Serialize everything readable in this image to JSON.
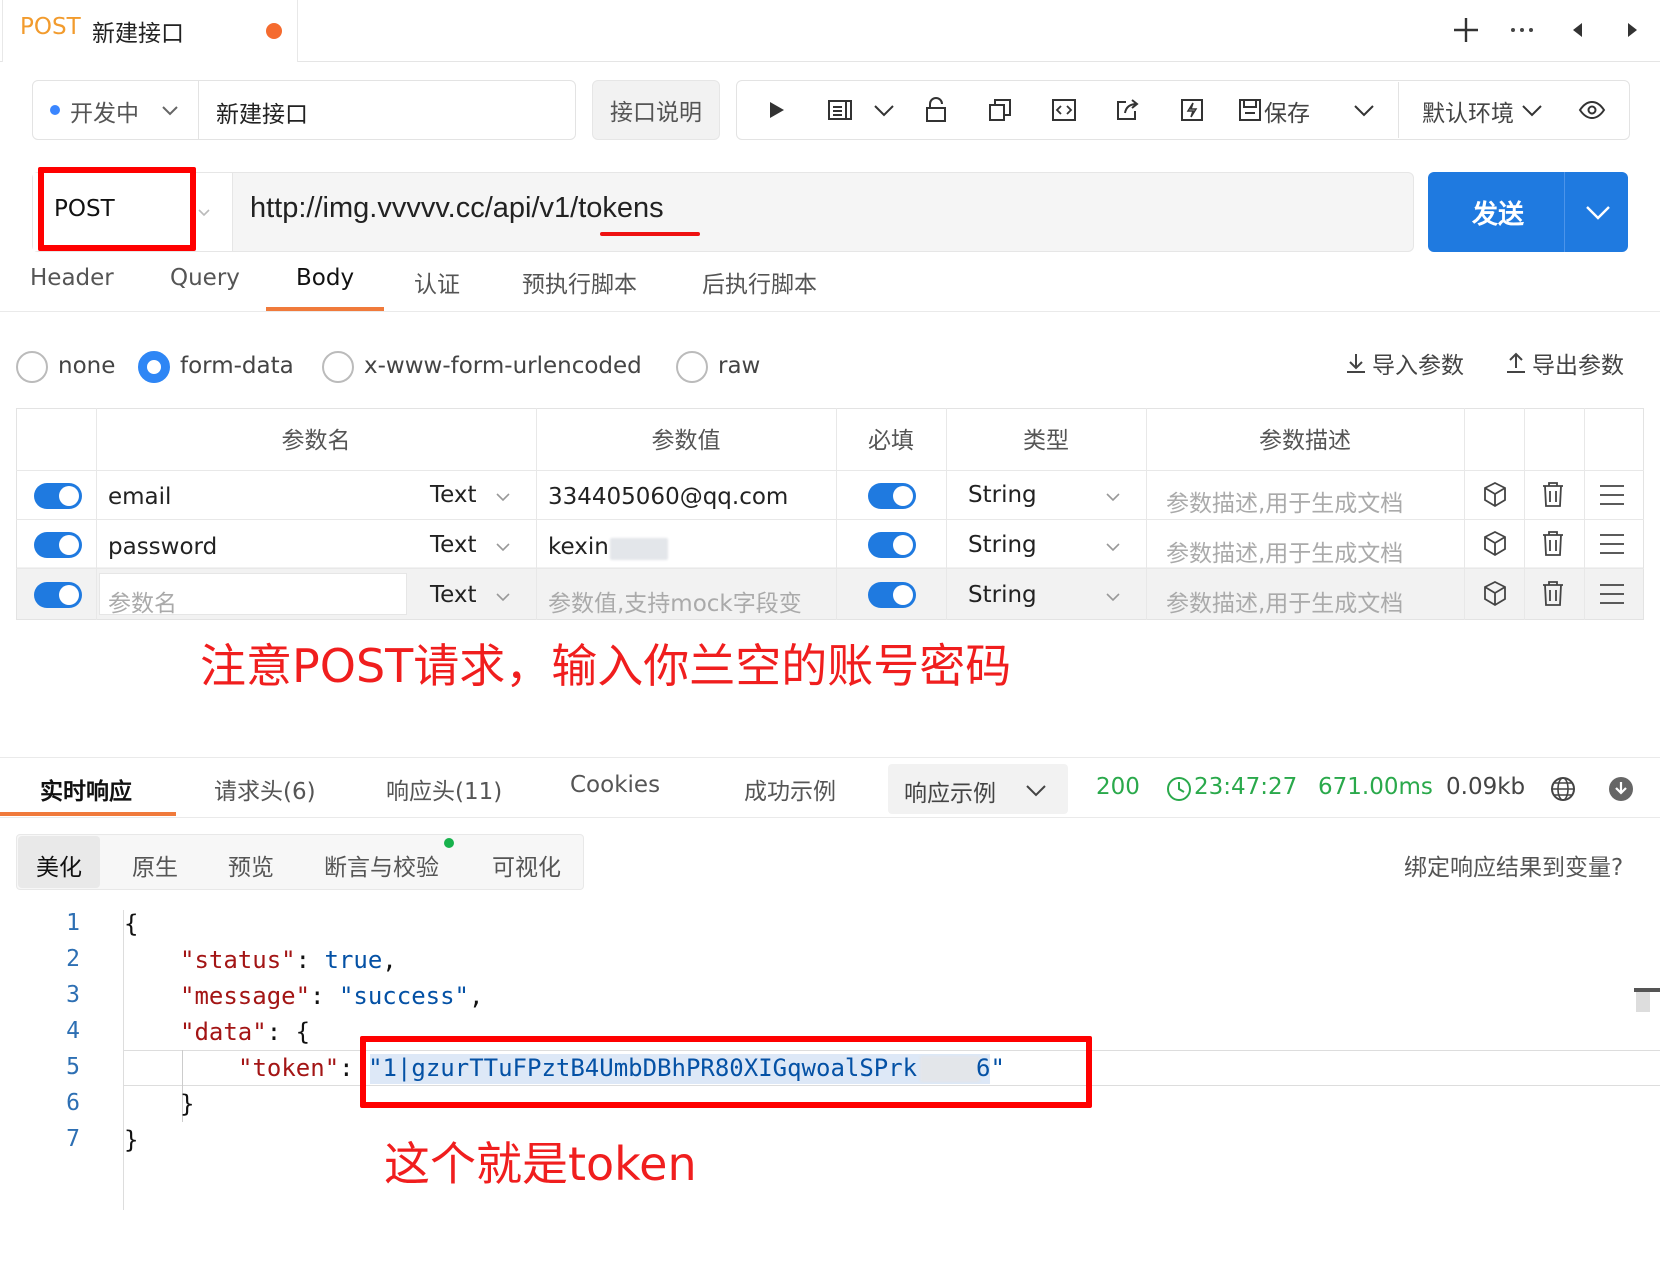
{
  "tab": {
    "method": "POST",
    "name": "新建接口"
  },
  "toolbar": {
    "status": "开发中",
    "api_name": "新建接口",
    "doc_button": "接口说明",
    "save_label": "保存",
    "environment": "默认环境"
  },
  "url_bar": {
    "method": "POST",
    "url": "http://img.vvvvv.cc/api/v1/tokens",
    "send_label": "发送"
  },
  "request_tabs": [
    "Header",
    "Query",
    "Body",
    "认证",
    "预执行脚本",
    "后执行脚本"
  ],
  "request_tab_active": "Body",
  "body_types": [
    "none",
    "form-data",
    "x-www-form-urlencoded",
    "raw"
  ],
  "body_type_selected": "form-data",
  "import_label": "导入参数",
  "export_label": "导出参数",
  "params_table": {
    "headers": [
      "参数名",
      "参数值",
      "必填",
      "类型",
      "参数描述"
    ],
    "rows": [
      {
        "enabled": true,
        "name": "email",
        "format": "Text",
        "value": "334405060@qq.com",
        "required": true,
        "type": "String",
        "description_placeholder": "参数描述,用于生成文档"
      },
      {
        "enabled": true,
        "name": "password",
        "format": "Text",
        "value": "kexin",
        "required": true,
        "type": "String",
        "description_placeholder": "参数描述,用于生成文档"
      },
      {
        "enabled": true,
        "name_placeholder": "参数名",
        "format": "Text",
        "value_placeholder": "参数值,支持mock字段变",
        "required": true,
        "type": "String",
        "description_placeholder": "参数描述,用于生成文档"
      }
    ]
  },
  "annotations": {
    "note_request": "注意POST请求，输入你兰空的账号密码",
    "note_token": "这个就是token"
  },
  "response_tabs": [
    "实时响应",
    "请求头(6)",
    "响应头(11)",
    "Cookies",
    "成功示例"
  ],
  "response_tab_active": "实时响应",
  "response_example_select": "响应示例",
  "response_stats": {
    "status": "200",
    "time": "23:47:27",
    "duration": "671.00ms",
    "size": "0.09kb"
  },
  "view_tabs": [
    "美化",
    "原生",
    "预览",
    "断言与校验",
    "可视化"
  ],
  "view_tab_active": "美化",
  "bind_label": "绑定响应结果到变量?",
  "code": {
    "line_numbers": [
      "1",
      "2",
      "3",
      "4",
      "5",
      "6",
      "7"
    ],
    "status_key": "\"status\"",
    "status_value": "true",
    "message_key": "\"message\"",
    "message_value": "\"success\"",
    "data_key": "\"data\"",
    "token_key": "\"token\"",
    "token_value_start": "\"1|gzurTTuFPztB4UmbDBhPR80XIGqwoalSPrk",
    "token_value_end": "6\""
  },
  "colors": {
    "primary": "#1f7ae0",
    "accent": "#f07a3b",
    "annotation": "#f01e1e",
    "success": "#2aa94b",
    "method": "#f29b2d"
  }
}
